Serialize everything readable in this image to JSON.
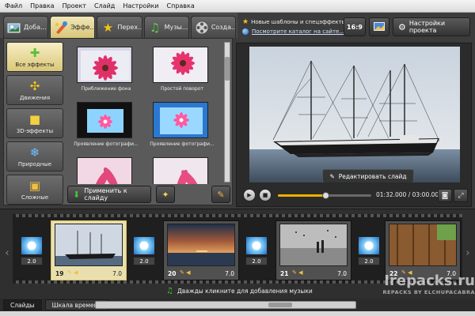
{
  "menu": [
    "Файл",
    "Правка",
    "Проект",
    "Слайд",
    "Настройки",
    "Справка"
  ],
  "tabs": [
    {
      "label": "Доба...",
      "icon": "add-photos-icon",
      "active": false
    },
    {
      "label": "Эффе...",
      "icon": "effects-brush-icon",
      "active": true
    },
    {
      "label": "Перех...",
      "icon": "star-icon",
      "active": false
    },
    {
      "label": "Музы...",
      "icon": "music-note-icon",
      "active": false
    },
    {
      "label": "Созда...",
      "icon": "film-reel-icon",
      "active": false
    }
  ],
  "info": {
    "line1": "Новые шаблоны и спецэффекты",
    "line2": "Посмотрите каталог на сайте...",
    "aspect": "16:9",
    "settings": "Настройки проекта"
  },
  "categories": [
    {
      "label": "Все эффекты",
      "icon": "puzzle-icon",
      "active": true
    },
    {
      "label": "Движения",
      "icon": "move-arrows-icon",
      "active": false
    },
    {
      "label": "3D-эффекты",
      "icon": "cube-icon",
      "active": false
    },
    {
      "label": "Природные",
      "icon": "snowflake-icon",
      "active": false
    },
    {
      "label": "Сложные",
      "icon": "layers-icon",
      "active": false
    }
  ],
  "effects": [
    {
      "caption": "Приближение фона"
    },
    {
      "caption": "Простой поворот"
    },
    {
      "caption": "Проявление фотографи..."
    },
    {
      "caption": "Проявление фотографи..."
    },
    {
      "caption": ""
    },
    {
      "caption": ""
    }
  ],
  "actions": {
    "apply": "Применить к слайду"
  },
  "preview": {
    "edit_label": "Редактировать слайд",
    "time": "01:32.000 / 03:00.000",
    "progress": 0.51
  },
  "timeline": {
    "slides": [
      {
        "num": "19",
        "dur": "7.0",
        "selected": true,
        "scene": "ship"
      },
      {
        "num": "20",
        "dur": "7.0",
        "selected": false,
        "scene": "sunset"
      },
      {
        "num": "21",
        "dur": "7.0",
        "selected": false,
        "scene": "bw"
      },
      {
        "num": "22",
        "dur": "7.0",
        "selected": false,
        "scene": "wood"
      }
    ],
    "transitions": [
      "2.0",
      "2.0",
      "2.0",
      "2.0"
    ],
    "music_hint": "Дважды кликните для добавления музыки"
  },
  "bottom_tabs": [
    "Слайды",
    "Шкала времени"
  ],
  "watermark": {
    "main": "Irepacks.ru",
    "sub": "REPACKS BY ELCHUPACABRA"
  }
}
